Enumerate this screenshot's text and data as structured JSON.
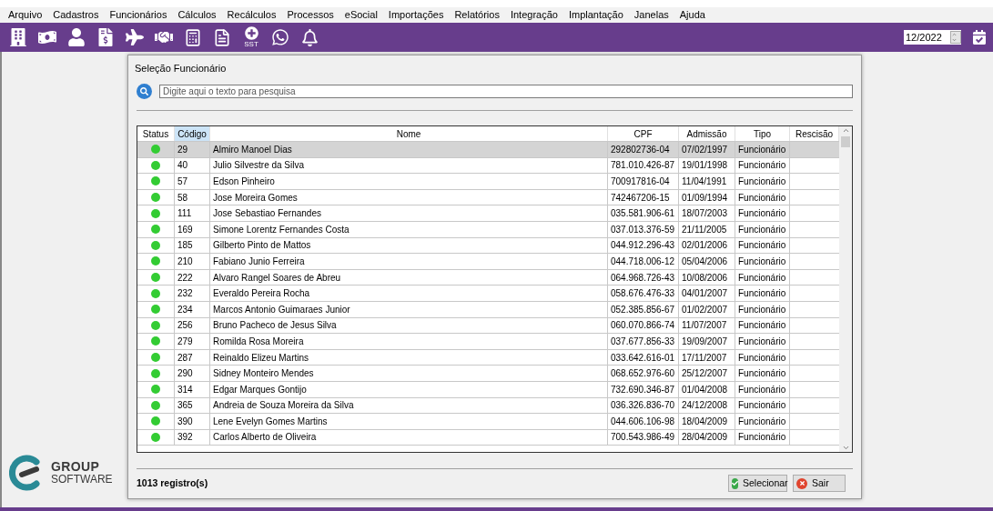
{
  "menu": [
    "Arquivo",
    "Cadastros",
    "Funcionários",
    "Cálculos",
    "Recálculos",
    "Processos",
    "eSocial",
    "Importações",
    "Relatórios",
    "Integração",
    "Implantação",
    "Janelas",
    "Ajuda"
  ],
  "toolbar": {
    "sst_label": "SST",
    "period": "12/2022"
  },
  "brand": {
    "line1": "GROUP",
    "line2": "SOFTWARE"
  },
  "dialog": {
    "title": "Seleção Funcionário",
    "search": {
      "placeholder": "Digite aqui o texto para pesquisa"
    },
    "table": {
      "columns": [
        {
          "label": "Status",
          "sorted": false
        },
        {
          "label": "Código",
          "sorted": true
        },
        {
          "label": "Nome",
          "sorted": false
        },
        {
          "label": "CPF",
          "sorted": false
        },
        {
          "label": "Admissão",
          "sorted": false
        },
        {
          "label": "Tipo",
          "sorted": false
        },
        {
          "label": "Rescisão",
          "sorted": false
        }
      ],
      "rows": [
        {
          "selected": true,
          "color": "#33cc33",
          "code": "29",
          "name": "Almiro Manoel Dias",
          "cpf": "292802736-04",
          "admission": "07/02/1997",
          "type": "Funcionário"
        },
        {
          "selected": false,
          "color": "#33cc33",
          "code": "40",
          "name": "Julio Silvestre da Silva",
          "cpf": "781.010.426-87",
          "admission": "19/01/1998",
          "type": "Funcionário"
        },
        {
          "selected": false,
          "color": "#33cc33",
          "code": "57",
          "name": "Edson Pinheiro",
          "cpf": "700917816-04",
          "admission": "11/04/1991",
          "type": "Funcionário"
        },
        {
          "selected": false,
          "color": "#33cc33",
          "code": "58",
          "name": "Jose Moreira Gomes",
          "cpf": "742467206-15",
          "admission": "01/09/1994",
          "type": "Funcionário"
        },
        {
          "selected": false,
          "color": "#33cc33",
          "code": "111",
          "name": "Jose Sebastiao Fernandes",
          "cpf": "035.581.906-61",
          "admission": "18/07/2003",
          "type": "Funcionário"
        },
        {
          "selected": false,
          "color": "#33cc33",
          "code": "169",
          "name": "Simone Lorentz Fernandes Costa",
          "cpf": "037.013.376-59",
          "admission": "21/11/2005",
          "type": "Funcionário"
        },
        {
          "selected": false,
          "color": "#33cc33",
          "code": "185",
          "name": "Gilberto Pinto de Mattos",
          "cpf": "044.912.296-43",
          "admission": "02/01/2006",
          "type": "Funcionário"
        },
        {
          "selected": false,
          "color": "#33cc33",
          "code": "210",
          "name": "Fabiano Junio Ferreira",
          "cpf": "044.718.006-12",
          "admission": "05/04/2006",
          "type": "Funcionário"
        },
        {
          "selected": false,
          "color": "#33cc33",
          "code": "222",
          "name": "Alvaro Rangel Soares de Abreu",
          "cpf": "064.968.726-43",
          "admission": "10/08/2006",
          "type": "Funcionário"
        },
        {
          "selected": false,
          "color": "#33cc33",
          "code": "232",
          "name": "Everaldo Pereira Rocha",
          "cpf": "058.676.476-33",
          "admission": "04/01/2007",
          "type": "Funcionário"
        },
        {
          "selected": false,
          "color": "#33cc33",
          "code": "234",
          "name": "Marcos Antonio Guimaraes Junior",
          "cpf": "052.385.856-67",
          "admission": "01/02/2007",
          "type": "Funcionário"
        },
        {
          "selected": false,
          "color": "#33cc33",
          "code": "256",
          "name": "Bruno Pacheco de Jesus Silva",
          "cpf": "060.070.866-74",
          "admission": "11/07/2007",
          "type": "Funcionário"
        },
        {
          "selected": false,
          "color": "#33cc33",
          "code": "279",
          "name": "Romilda Rosa Moreira",
          "cpf": "037.677.856-33",
          "admission": "19/09/2007",
          "type": "Funcionário"
        },
        {
          "selected": false,
          "color": "#33cc33",
          "code": "287",
          "name": "Reinaldo Elizeu Martins",
          "cpf": "033.642.616-01",
          "admission": "17/11/2007",
          "type": "Funcionário"
        },
        {
          "selected": false,
          "color": "#33cc33",
          "code": "290",
          "name": "Sidney Monteiro Mendes",
          "cpf": "068.652.976-60",
          "admission": "25/12/2007",
          "type": "Funcionário"
        },
        {
          "selected": false,
          "color": "#33cc33",
          "code": "314",
          "name": "Edgar Marques Gontijo",
          "cpf": "732.690.346-87",
          "admission": "01/04/2008",
          "type": "Funcionário"
        },
        {
          "selected": false,
          "color": "#33cc33",
          "code": "365",
          "name": "Andreia de Souza Moreira da Silva",
          "cpf": "036.326.836-70",
          "admission": "24/12/2008",
          "type": "Funcionário"
        },
        {
          "selected": false,
          "color": "#33cc33",
          "code": "390",
          "name": "Lene Evelyn Gomes Martins",
          "cpf": "044.606.106-98",
          "admission": "18/04/2009",
          "type": "Funcionário"
        },
        {
          "selected": false,
          "color": "#33cc33",
          "code": "392",
          "name": "Carlos Alberto de Oliveira",
          "cpf": "700.543.986-49",
          "admission": "28/04/2009",
          "type": "Funcionário"
        }
      ]
    },
    "record_count": "1013 registro(s)",
    "buttons": [
      {
        "kind": "confirm",
        "label": "Selecionar"
      },
      {
        "kind": "cancel",
        "label": "Sair"
      }
    ]
  }
}
